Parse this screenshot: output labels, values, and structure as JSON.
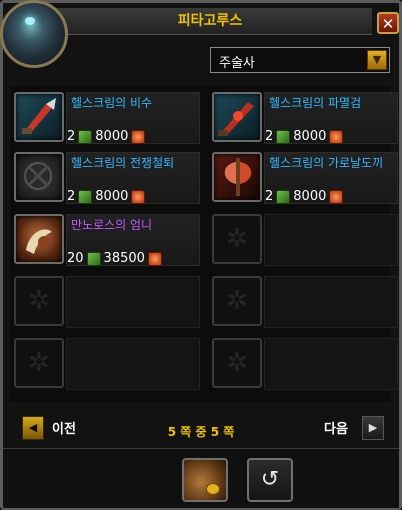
{
  "window": {
    "title": "피타고루스"
  },
  "filter": {
    "selected": "주술사"
  },
  "items": [
    {
      "name": "헬스크림의 비수",
      "qty": "2",
      "price": "8000",
      "name_color": "blue"
    },
    {
      "name": "헬스크림의 파멸검",
      "qty": "2",
      "price": "8000",
      "name_color": "blue"
    },
    {
      "name": "헬스크림의 전쟁철퇴",
      "qty": "2",
      "price": "8000",
      "name_color": "blue"
    },
    {
      "name": "헬스크림의 가로날도끼",
      "qty": "2",
      "price": "8000",
      "name_color": "blue"
    },
    {
      "name": "만노로스의 엄니",
      "qty": "20",
      "price": "38500",
      "name_color": "purple"
    }
  ],
  "pager": {
    "prev": "이전",
    "next": "다음",
    "page_info": "5 쪽 중 5 쪽"
  },
  "icons": {
    "portrait": "dragon-portrait-icon",
    "close": "close-icon",
    "dropdown": "chevron-down-icon",
    "currency_secondary": "green-token-icon",
    "currency_primary": "red-ore-icon",
    "bag": "money-bag-icon",
    "undo": "undo-icon"
  },
  "colors": {
    "title": "#f2c200",
    "item_blue": "#32b8ff",
    "item_purple": "#c25aff",
    "accent_gold": "#e2b21c"
  }
}
